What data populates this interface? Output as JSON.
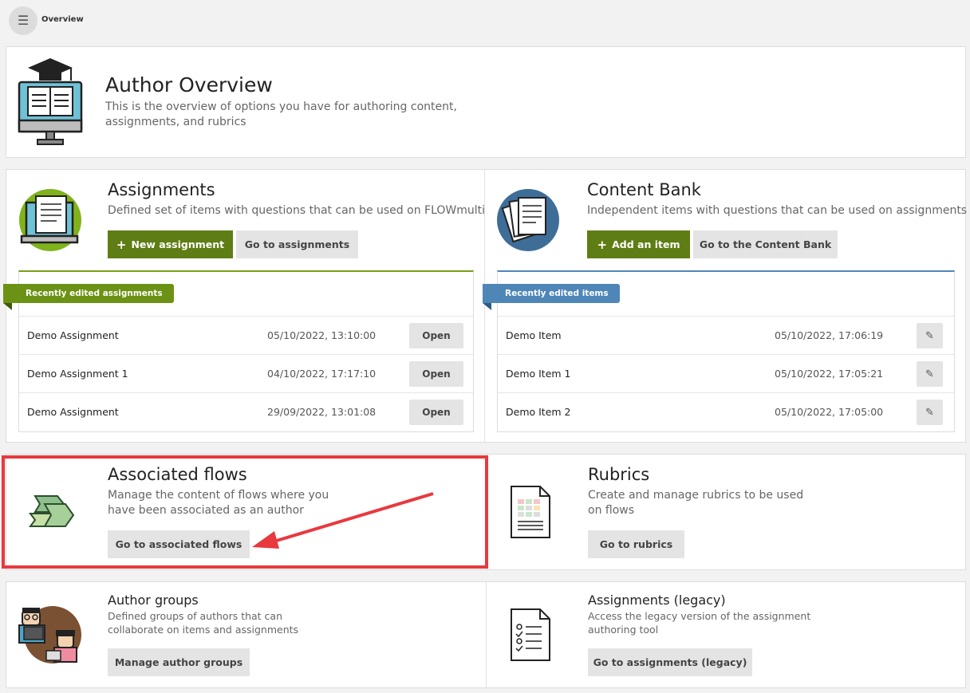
{
  "header": {
    "breadcrumb": "Overview",
    "menu_icon": "hamburger-icon"
  },
  "hero": {
    "title": "Author Overview",
    "description": "This is the overview of options you have for authoring content, assignments, and rubrics",
    "icon": "graduation-laptop-icon"
  },
  "assignments": {
    "title": "Assignments",
    "description": "Defined set of items with questions that can be used on FLOWmulti",
    "new_label": "New assignment",
    "go_label": "Go to assignments",
    "recent_label": "Recently edited assignments",
    "open_label": "Open",
    "rows": [
      {
        "name": "Demo Assignment",
        "date": "05/10/2022, 13:10:00"
      },
      {
        "name": "Demo Assignment 1",
        "date": "04/10/2022, 17:17:10"
      },
      {
        "name": "Demo Assignment",
        "date": "29/09/2022, 13:01:08"
      }
    ]
  },
  "content_bank": {
    "title": "Content Bank",
    "description": "Independent items with questions that can be used on assignments",
    "add_label": "Add an item",
    "go_label": "Go to the Content Bank",
    "recent_label": "Recently edited items",
    "rows": [
      {
        "name": "Demo Item",
        "date": "05/10/2022, 17:06:19"
      },
      {
        "name": "Demo Item 1",
        "date": "05/10/2022, 17:05:21"
      },
      {
        "name": "Demo Item 2",
        "date": "05/10/2022, 17:05:00"
      }
    ]
  },
  "flows": {
    "title": "Associated flows",
    "description_line1": "Manage the content of flows where you",
    "description_line2": "have been associated as an author",
    "go_label": "Go to associated flows"
  },
  "rubrics": {
    "title": "Rubrics",
    "description_line1": "Create and manage rubrics to be used",
    "description_line2": "on flows",
    "go_label": "Go to rubrics"
  },
  "author_groups": {
    "title": "Author groups",
    "description_line1": "Defined groups of authors that can",
    "description_line2": "collaborate on items and assignments",
    "go_label": "Manage author groups"
  },
  "legacy": {
    "title": "Assignments (legacy)",
    "description_line1": "Access the legacy version of the assignment",
    "description_line2": "authoring tool",
    "go_label": "Go to assignments (legacy)"
  },
  "colors": {
    "green": "#5e7d14",
    "blue": "#4f86b8",
    "highlight": "#e8393f"
  }
}
